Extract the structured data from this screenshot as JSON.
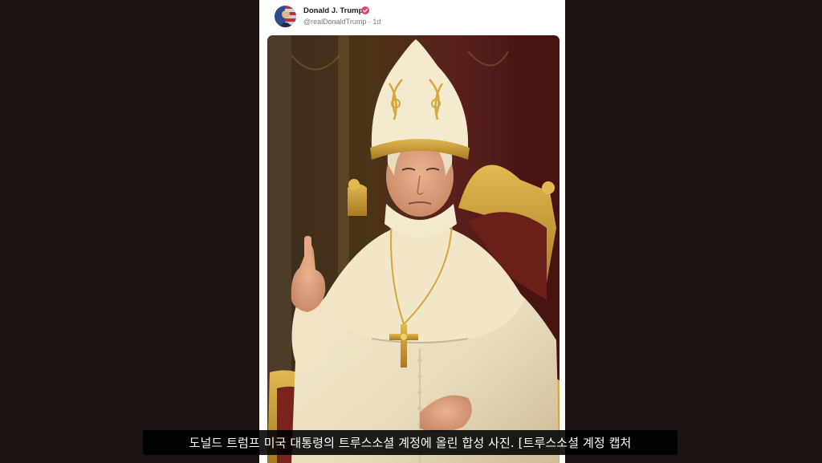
{
  "post": {
    "author_name": "Donald J. Trump",
    "handle_and_time": "@realDonaldTrump · 1d",
    "avatar_icon": "flag-portrait-avatar",
    "verified_icon": "verified-check-icon",
    "verified_color": "#e8436a",
    "image_subject": "portrait"
  },
  "caption": {
    "text": "도널드 트럼프 미국 대통령의 트루스소셜 계정에 올린 합성 사진. [트루스소셜 계정 캡처"
  },
  "colors": {
    "page_background": "#1c1410",
    "card_background": "#ffffff",
    "caption_background": "#000000",
    "caption_text": "#ffffff"
  }
}
